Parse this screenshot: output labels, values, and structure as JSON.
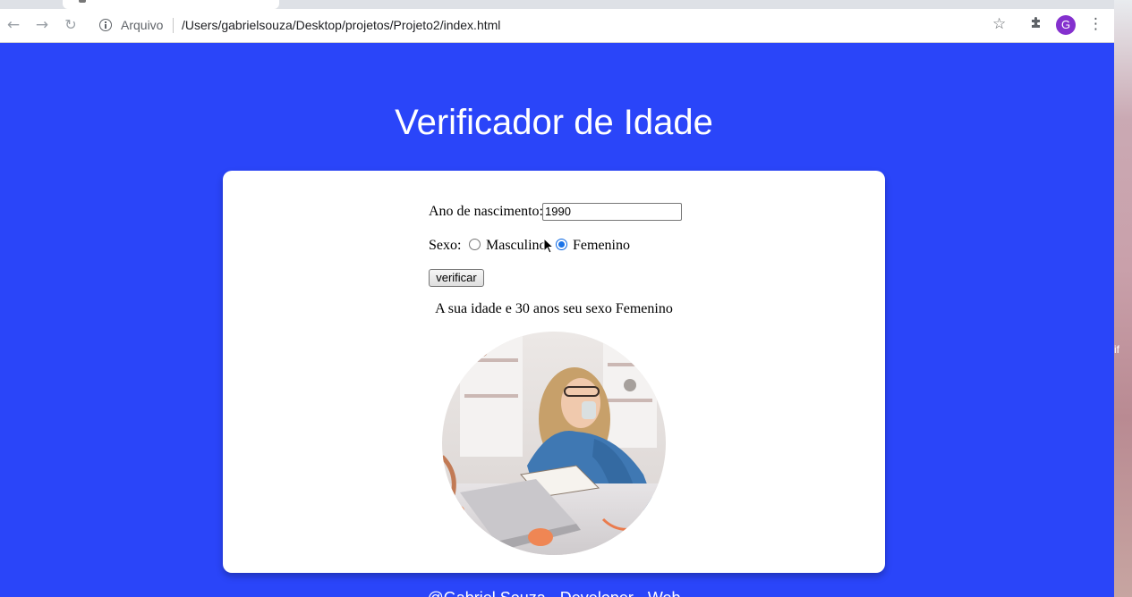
{
  "browser": {
    "address_label": "Arquivo",
    "url": "/Users/gabrielsouza/Desktop/projetos/Projeto2/index.html",
    "avatar_letter": "G",
    "icons": [
      "back-arrow-icon",
      "forward-arrow-icon",
      "reload-icon",
      "info-icon",
      "star-icon",
      "puzzle-extension-icon",
      "kebab-menu-icon"
    ]
  },
  "page": {
    "title": "Verificador de Idade",
    "form": {
      "year_label": "Ano de nascimento:",
      "year_value": "1990",
      "sex_label": "Sexo:",
      "options": [
        {
          "label": "Masculino",
          "checked": false
        },
        {
          "label": "Femenino",
          "checked": true
        }
      ],
      "button_label": "verificar"
    },
    "result": "A sua idade e 30 anos seu sexo Femenino",
    "footer": "@Gabriel Souza - Developer - Web"
  },
  "desktop": {
    "edge_text": "if"
  },
  "colors": {
    "page_background": "#2a45f9",
    "card": "#ffffff",
    "avatar": "#8430ce",
    "radio_checked": "#1a73e8"
  }
}
